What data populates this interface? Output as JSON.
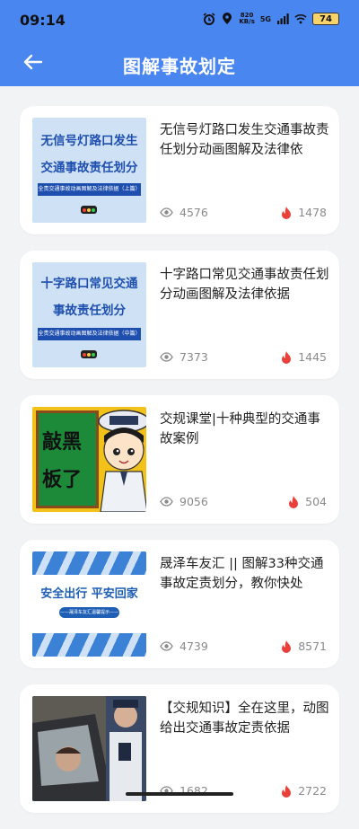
{
  "status": {
    "time": "09:14",
    "net_speed": "820",
    "net_unit": "KB/s",
    "signal": "5G",
    "battery": "74"
  },
  "header": {
    "title": "图解事故划定"
  },
  "thumbs": {
    "t1": {
      "line1": "无信号灯路口发生",
      "line2": "交通事故责任划分",
      "sub": "全责交通事故动画图解及法律依据（上篇）"
    },
    "t2": {
      "line1": "十字路口常见交通",
      "line2": "事故责任划分",
      "sub": "全责交通事故动画图解及法律依据（中篇）"
    },
    "t3": {
      "text1": "敲黑",
      "text2": "板了"
    },
    "t4": {
      "main": "安全出行 平安回家",
      "sub": "——晟泽车友汇温馨提示——"
    }
  },
  "articles": [
    {
      "title": "无信号灯路口发生交通事故责任划分动画图解及法律依",
      "views": "4576",
      "likes": "1478"
    },
    {
      "title": "十字路口常见交通事故责任划分动画图解及法律依据",
      "views": "7373",
      "likes": "1445"
    },
    {
      "title": "交规课堂|十种典型的交通事故案例",
      "views": "9056",
      "likes": "504"
    },
    {
      "title": "晟泽车友汇 || 图解33种交通事故定责划分，教你快处",
      "views": "4739",
      "likes": "8571"
    },
    {
      "title": "【交规知识】全在这里，动图给出交通事故定责依据",
      "views": "1682",
      "likes": "2722"
    }
  ],
  "colors": {
    "primary": "#4a86f0",
    "flame": "#e8413b",
    "background": "#f2f3f5"
  },
  "icons": {
    "back": "arrow-left-icon",
    "views": "eye-icon",
    "likes": "flame-icon"
  }
}
